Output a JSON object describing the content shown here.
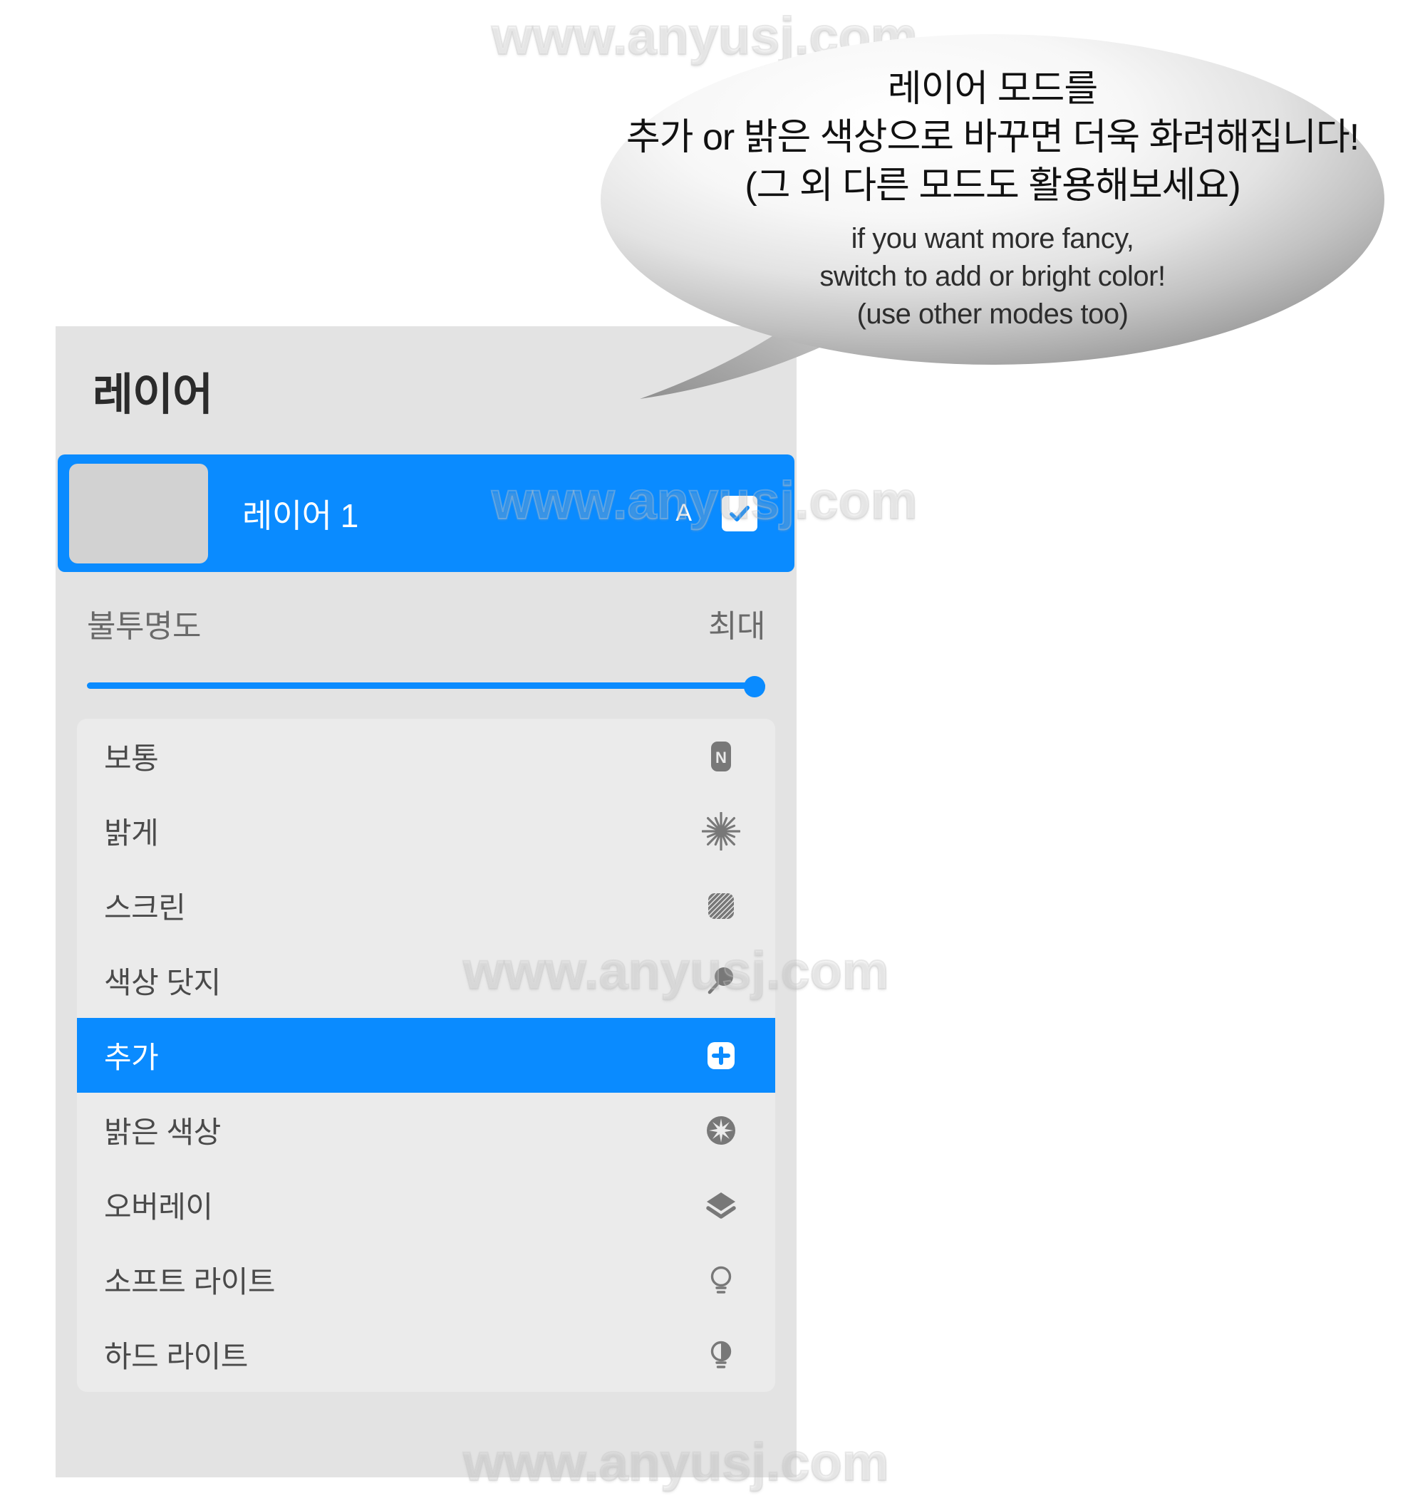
{
  "watermark": {
    "text": "www.anyusj.com"
  },
  "panel": {
    "title": "레이어",
    "layer": {
      "name": "레이어 1",
      "alpha_label": "A",
      "visible": true,
      "thumbnail_color": "#d2d2d2",
      "row_color": "#0a8bff"
    },
    "opacity": {
      "label": "불투명도",
      "value_label": "최대",
      "percent": 100,
      "accent_color": "#0a8bff"
    },
    "blend_modes": {
      "selected": "추가",
      "items": [
        {
          "label": "보통",
          "icon": "normal-n-icon",
          "selected": false
        },
        {
          "label": "밝게",
          "icon": "starburst-icon",
          "selected": false
        },
        {
          "label": "스크린",
          "icon": "hatched-square-icon",
          "selected": false
        },
        {
          "label": "색상 닷지",
          "icon": "magnifier-icon",
          "selected": false
        },
        {
          "label": "추가",
          "icon": "plus-square-icon",
          "selected": true
        },
        {
          "label": "밝은 색상",
          "icon": "star-circle-icon",
          "selected": false
        },
        {
          "label": "오버레이",
          "icon": "layers-icon",
          "selected": false
        },
        {
          "label": "소프트 라이트",
          "icon": "bulb-outline-icon",
          "selected": false
        },
        {
          "label": "하드 라이트",
          "icon": "bulb-filled-icon",
          "selected": false
        }
      ]
    }
  },
  "callout": {
    "ko_line1": "레이어 모드를",
    "ko_line2": "추가 or 밝은 색상으로 바꾸면 더욱 화려해집니다!",
    "ko_line3": "(그 외 다른 모드도 활용해보세요)",
    "en_line1": "if you want more fancy,",
    "en_line2": "switch to add or bright color!",
    "en_line3": "(use other modes too)"
  }
}
